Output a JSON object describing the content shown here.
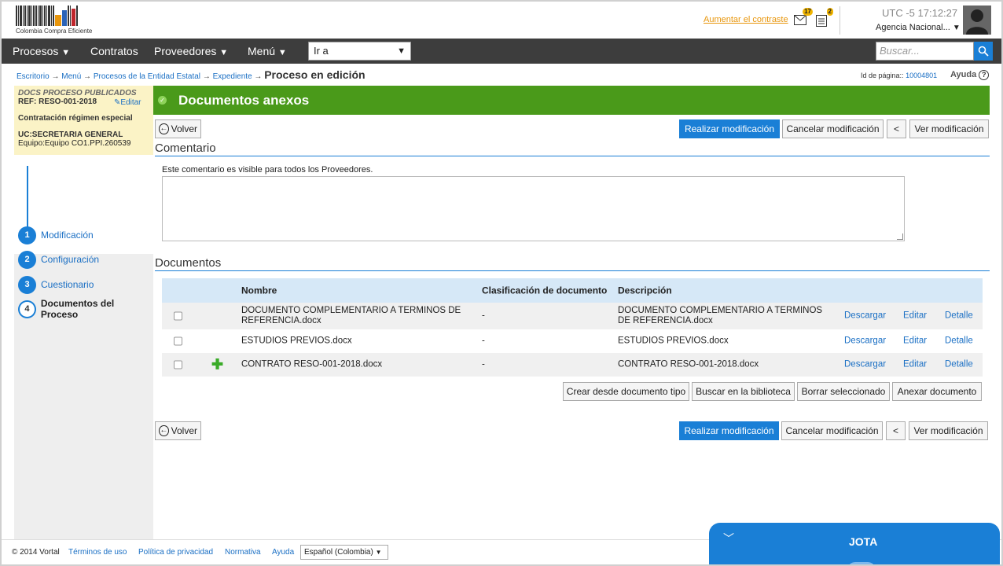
{
  "header": {
    "logo_text": "Colombia Compra Eficiente",
    "contrast_link": "Aumentar el contraste",
    "mail_count": "17",
    "tasks_count": "2",
    "utc_label": "UTC -5",
    "time": "17:12:27",
    "agency": "Agencia Nacional..."
  },
  "nav": {
    "items": [
      "Procesos",
      "Contratos",
      "Proveedores",
      "Menú"
    ],
    "goto_value": "Ir a",
    "search_placeholder": "Buscar..."
  },
  "breadcrumb": {
    "items": [
      "Escritorio",
      "Menú",
      "Procesos de la Entidad Estatal",
      "Expediente"
    ],
    "current": "Proceso en edición",
    "page_id_label": "Id de página::",
    "page_id": "10004801",
    "help": "Ayuda"
  },
  "sidebar": {
    "status": "DOCS PROCESO PUBLICADOS",
    "ref": "REF: RESO-001-2018",
    "edit": "Editar",
    "regime": "Contratación régimen especial",
    "uc": "UC:SECRETARIA GENERAL",
    "team": "Equipo:Equipo CO1.PPI.260539",
    "steps": [
      {
        "num": "1",
        "label": "Modificación"
      },
      {
        "num": "2",
        "label": "Configuración"
      },
      {
        "num": "3",
        "label": "Cuestionario"
      },
      {
        "num": "4",
        "label": "Documentos del Proceso"
      }
    ]
  },
  "main": {
    "title": "Documentos anexos",
    "back": "Volver",
    "make_change": "Realizar modificación",
    "cancel_change": "Cancelar modificación",
    "prev": "<",
    "view_change": "Ver modificación",
    "comment_title": "Comentario",
    "comment_note": "Este comentario es visible para todos los Proveedores.",
    "docs_title": "Documentos",
    "columns": [
      "Nombre",
      "Clasificación de documento",
      "Descripción"
    ],
    "rows": [
      {
        "name": "DOCUMENTO COMPLEMENTARIO A TERMINOS DE REFERENCIA.docx",
        "class": "-",
        "desc": "DOCUMENTO COMPLEMENTARIO A TERMINOS DE REFERENCIA.docx"
      },
      {
        "name": "ESTUDIOS PREVIOS.docx",
        "class": "-",
        "desc": "ESTUDIOS PREVIOS.docx"
      },
      {
        "name": "CONTRATO RESO-001-2018.docx",
        "class": "-",
        "desc": "CONTRATO RESO-001-2018.docx"
      }
    ],
    "actions": {
      "download": "Descargar",
      "edit": "Editar",
      "detail": "Detalle"
    },
    "doc_buttons": [
      "Crear desde documento tipo",
      "Buscar en la biblioteca",
      "Borrar seleccionado",
      "Anexar documento"
    ]
  },
  "footer": {
    "copyright": "© 2014 Vortal",
    "links": [
      "Términos de uso",
      "Política de privacidad",
      "Normativa",
      "Ayuda"
    ],
    "language": "Español (Colombia)"
  },
  "chat": {
    "name": "JOTA"
  }
}
